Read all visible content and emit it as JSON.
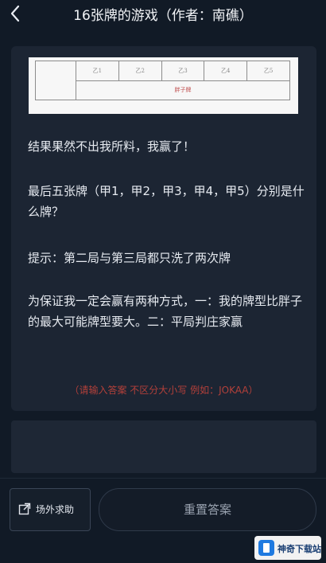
{
  "header": {
    "title": "16张牌的游戏（作者：南礁）"
  },
  "question": {
    "figure_cells": [
      "乙1",
      "乙2",
      "乙3",
      "乙4",
      "乙5"
    ],
    "figure_label": "胖子牌",
    "paragraphs": [
      "结果果然不出我所料，我赢了！",
      "最后五张牌（甲1，甲2，甲3，甲4，甲5）分别是什么牌？",
      "提示：第二局与第三局都只洗了两次牌",
      "为保证我一定会赢有两种方式，一：我的牌型比胖子的最大可能牌型要大。二：平局判庄家赢"
    ],
    "answer_hint": "（请输入答案 不区分大小写 例如：JOKAA）"
  },
  "footer": {
    "help_label": "场外求助",
    "reset_label": "重置答案"
  },
  "watermark": {
    "text": "神奇下载站"
  }
}
